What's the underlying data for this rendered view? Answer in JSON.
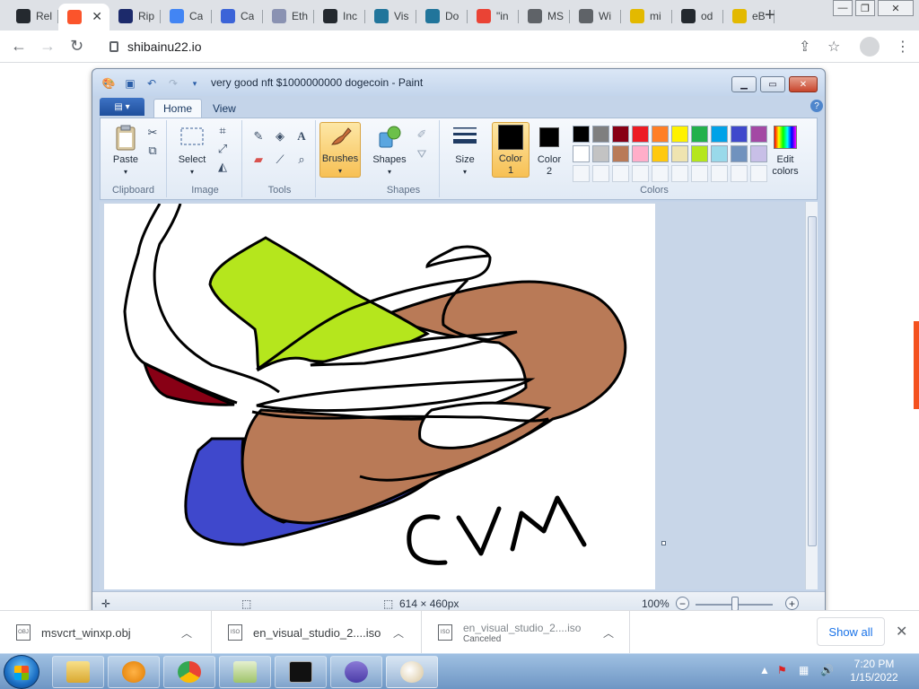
{
  "browser": {
    "tabs": [
      {
        "label": "Rel",
        "icon": "github-icon",
        "color": "#24292f"
      },
      {
        "label": "",
        "icon": "brave-shield-icon",
        "color": "#fb542b",
        "active": true
      },
      {
        "label": "Rip",
        "icon": "ripple-icon",
        "color": "#1c2a6b"
      },
      {
        "label": "Ca",
        "icon": "gear-favicon-icon",
        "color": "#4285f4"
      },
      {
        "label": "Ca",
        "icon": "circle-favicon-icon",
        "color": "#3c64d8"
      },
      {
        "label": "Eth",
        "icon": "ethereum-icon",
        "color": "#8a92b2"
      },
      {
        "label": "Inc",
        "icon": "github-icon",
        "color": "#24292f"
      },
      {
        "label": "Vis",
        "icon": "wordpress-icon",
        "color": "#21759b"
      },
      {
        "label": "Do",
        "icon": "wordpress-icon",
        "color": "#21759b"
      },
      {
        "label": "\"in",
        "icon": "google-icon",
        "color": "#ea4335"
      },
      {
        "label": "MS",
        "icon": "globe-icon",
        "color": "#5f6368"
      },
      {
        "label": "Wi",
        "icon": "globe-icon",
        "color": "#5f6368"
      },
      {
        "label": "mi",
        "icon": "shopping-bag-icon",
        "color": "#e3b900"
      },
      {
        "label": "od",
        "icon": "github-icon",
        "color": "#24292f"
      },
      {
        "label": "eB",
        "icon": "shopping-bag-icon",
        "color": "#e3b900"
      }
    ],
    "url": "shibainu22.io"
  },
  "paint": {
    "title": "very good nft $1000000000 dogecoin - Paint",
    "tabs": {
      "home": "Home",
      "view": "View"
    },
    "groups": {
      "clipboard": "Clipboard",
      "image": "Image",
      "tools": "Tools",
      "shapes": "Shapes",
      "colors": "Colors"
    },
    "buttons": {
      "paste": "Paste",
      "select": "Select",
      "brushes": "Brushes",
      "shapes": "Shapes",
      "size": "Size",
      "color1_line1": "Color",
      "color1_line2": "1",
      "color2_line1": "Color",
      "color2_line2": "2",
      "edit_colors_line1": "Edit",
      "edit_colors_line2": "colors"
    },
    "palette_row1": [
      "#000000",
      "#7f7f7f",
      "#880015",
      "#ed1c24",
      "#ff7f27",
      "#fff200",
      "#22b14c",
      "#00a2e8",
      "#3f48cc",
      "#a349a4"
    ],
    "palette_row2": [
      "#ffffff",
      "#c3c3c3",
      "#b97a57",
      "#ffaec9",
      "#ffc90e",
      "#efe4b0",
      "#b5e61d",
      "#99d9ea",
      "#7092be",
      "#c8bfe7"
    ],
    "color1": "#000000",
    "color2": "#000000",
    "canvas_text": "CVM",
    "status": {
      "dimensions": "614 × 460px",
      "zoom": "100%"
    }
  },
  "downloads": {
    "items": [
      {
        "name": "msvcrt_winxp.obj",
        "status": ""
      },
      {
        "name": "en_visual_studio_2....iso",
        "status": ""
      },
      {
        "name": "en_visual_studio_2....iso",
        "status": "Canceled"
      }
    ],
    "show_all": "Show all"
  },
  "taskbar": {
    "time": "7:20 PM",
    "date": "1/15/2022"
  }
}
